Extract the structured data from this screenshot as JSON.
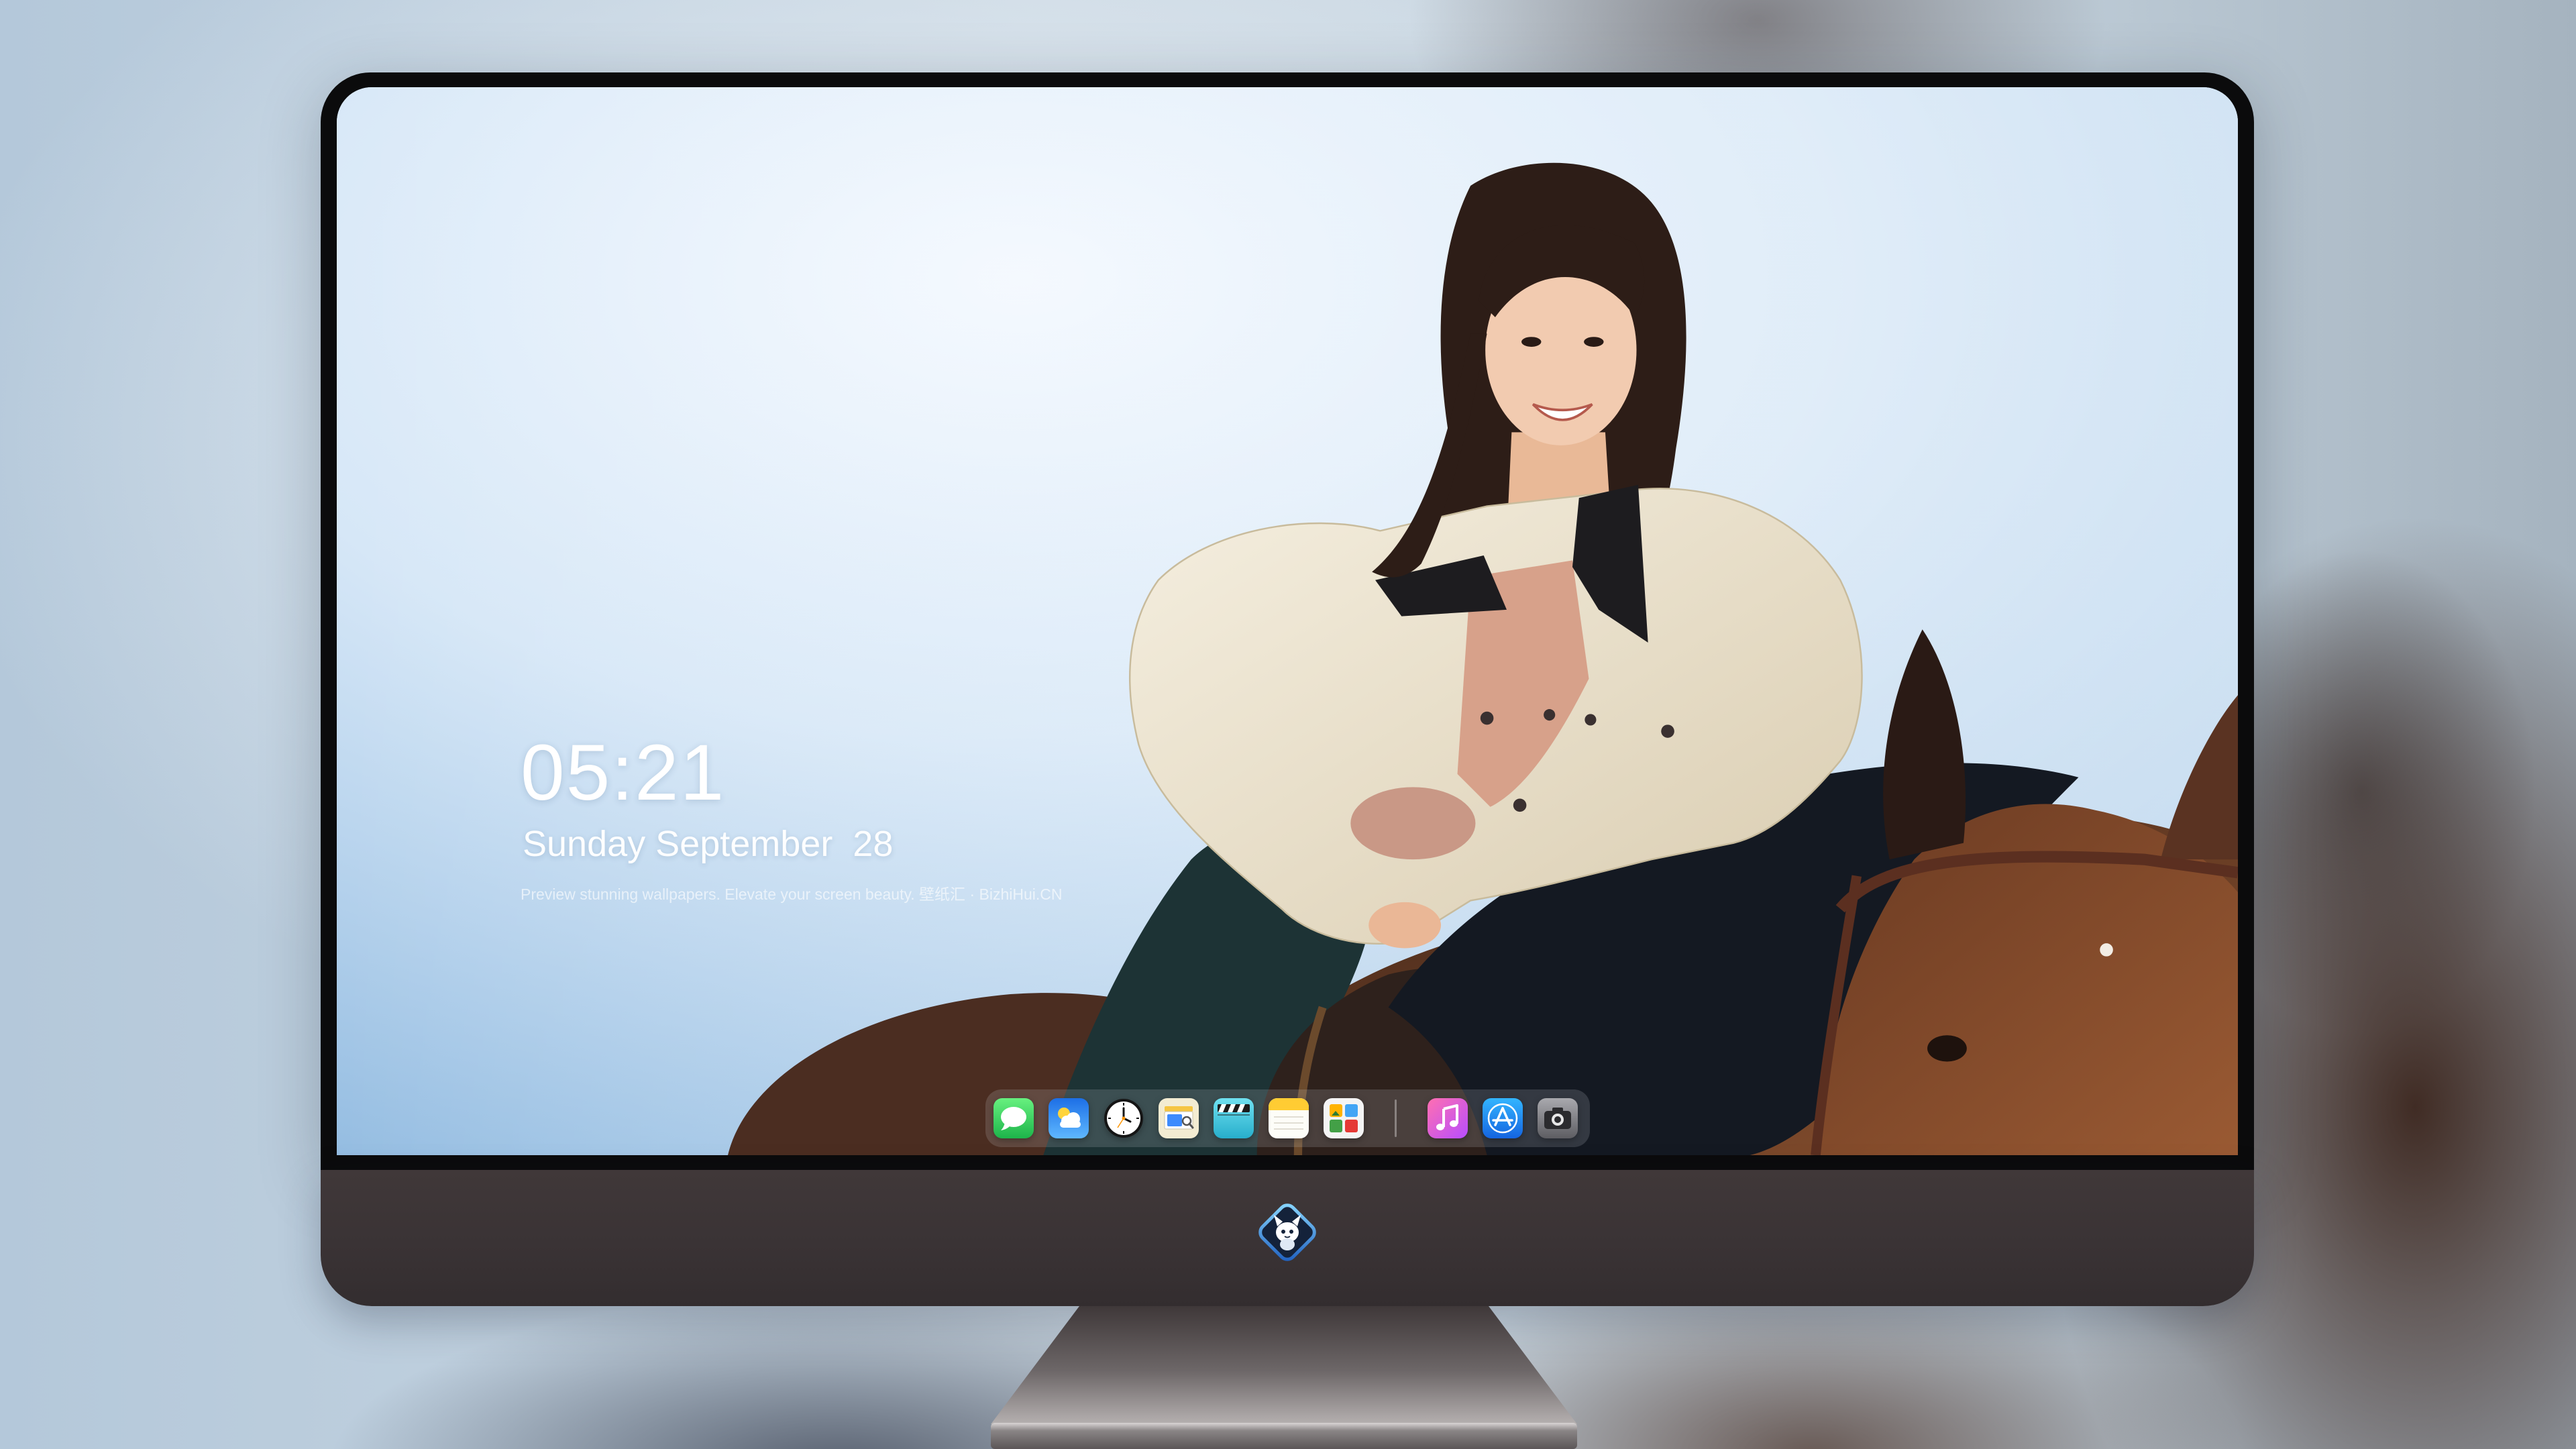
{
  "lockscreen": {
    "time": "05:21",
    "date": "Sunday September  28",
    "tagline": "Preview stunning wallpapers. Elevate your screen beauty. 壁纸汇 · BizhiHui.CN",
    "text_color": "#ffffff"
  },
  "dock": {
    "icons": [
      {
        "icon": "messages-icon",
        "color": "#34c759"
      },
      {
        "icon": "weather-icon",
        "color": "#2f8cf0"
      },
      {
        "icon": "clock-icon",
        "color": "#151515"
      },
      {
        "icon": "preview-icon",
        "color": "#f5c542"
      },
      {
        "icon": "clapperboard-icon",
        "color": "#3fc1d8"
      },
      {
        "icon": "notes-icon",
        "color": "#ffcc33"
      },
      {
        "icon": "photo-grid-icon",
        "color": "#43a047"
      },
      {
        "icon": "music-icon",
        "color": "#f14bb2"
      },
      {
        "icon": "app-store-icon",
        "color": "#1e88e5"
      },
      {
        "icon": "camera-icon",
        "color": "#6b6b70"
      }
    ]
  },
  "monitor": {
    "chin_logo_icon": "mascot-logo-icon",
    "bezel_color": "#0b0b0c",
    "chin_color": "#3b3436"
  }
}
